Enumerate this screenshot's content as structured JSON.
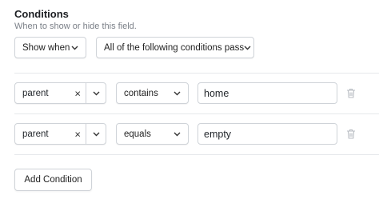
{
  "header": {
    "title": "Conditions",
    "subtitle": "When to show or hide this field."
  },
  "visibility": {
    "mode": "Show when",
    "match": "All of the following conditions pass"
  },
  "conditions": [
    {
      "field": "parent",
      "clear_glyph": "×",
      "operator": "contains",
      "value": "home"
    },
    {
      "field": "parent",
      "clear_glyph": "×",
      "operator": "equals",
      "value": "empty"
    }
  ],
  "actions": {
    "add_condition": "Add Condition"
  },
  "icons": {
    "chevron": "chevron-down-icon",
    "trash": "trash-icon",
    "clear": "close-icon"
  },
  "colors": {
    "border": "#cfd3d8",
    "divider": "#e6e8eb",
    "muted": "#7a7f87"
  }
}
